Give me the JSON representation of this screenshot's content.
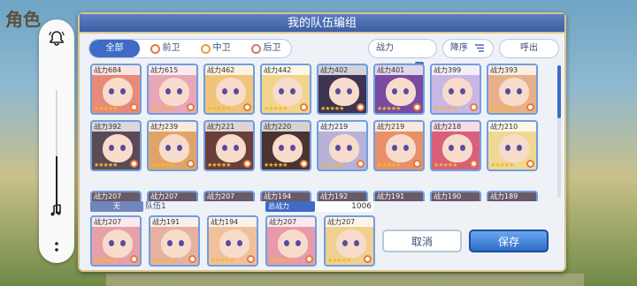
{
  "background": {
    "logo_text": "角色"
  },
  "sidebar": {
    "icons": [
      "bell-icon",
      "music-icon",
      "more-icon"
    ]
  },
  "dialog": {
    "title": "我的队伍编组",
    "tabs": [
      {
        "label": "全部",
        "active": true
      },
      {
        "label": "前卫",
        "active": false
      },
      {
        "label": "中卫",
        "active": false
      },
      {
        "label": "后卫",
        "active": false
      }
    ],
    "sort_label": "战力",
    "order_label": "降序",
    "callout_label": "呼出",
    "cards": [
      {
        "power": "战力684",
        "color": "#e88a7a"
      },
      {
        "power": "战力615",
        "color": "#e8a6b8"
      },
      {
        "power": "战力462",
        "color": "#f0c47a"
      },
      {
        "power": "战力442",
        "color": "#f1d48e"
      },
      {
        "power": "战力402",
        "color": "#3e3450"
      },
      {
        "power": "战力401",
        "color": "#7a4aa0"
      },
      {
        "power": "战力399",
        "color": "#c8b6e4"
      },
      {
        "power": "战力393",
        "color": "#e8b08a"
      },
      {
        "power": "战力392",
        "color": "#5a4a58"
      },
      {
        "power": "战力239",
        "color": "#e0a46a"
      },
      {
        "power": "战力221",
        "color": "#6a3e3a"
      },
      {
        "power": "战力220",
        "color": "#4a3430"
      },
      {
        "power": "战力219",
        "color": "#b8b2d6"
      },
      {
        "power": "战力219",
        "color": "#e8906a"
      },
      {
        "power": "战力218",
        "color": "#d8607a"
      },
      {
        "power": "战力210",
        "color": "#f0d894"
      }
    ],
    "row3_powers": [
      "战力207",
      "战力207",
      "战力207",
      "战力194",
      "战力192",
      "战力191",
      "战力190",
      "战力189"
    ],
    "party_label": "无",
    "party_name": "队伍1",
    "total_power_label": "总战力",
    "total_power_value": "1006",
    "party": [
      {
        "power": "战力207",
        "color": "#e8a0a8"
      },
      {
        "power": "战力191",
        "color": "#e8b0a0"
      },
      {
        "power": "战力194",
        "color": "#f0c09a"
      },
      {
        "power": "战力207",
        "color": "#e89aa8"
      },
      {
        "power": "战力207",
        "color": "#f0d090"
      }
    ],
    "cancel_label": "取消",
    "save_label": "保存"
  }
}
